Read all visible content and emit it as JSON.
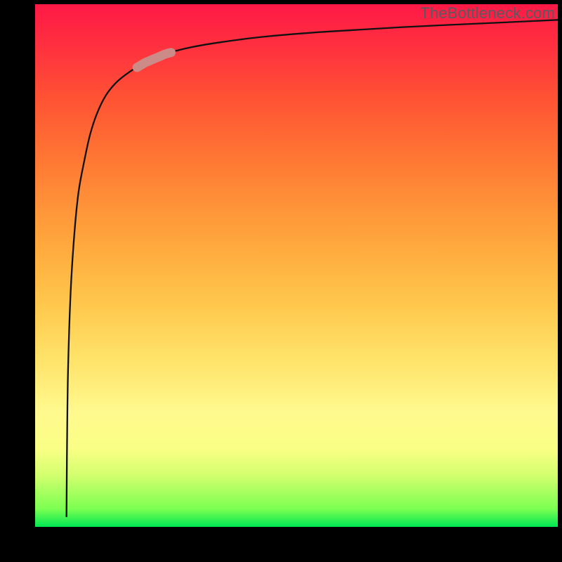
{
  "watermark": "TheBottleneck.com",
  "colors": {
    "frame": "#000000",
    "curve": "#111111",
    "highlight_fill": "#cc8b86",
    "highlight_stroke": "#cc8b86"
  },
  "chart_data": {
    "type": "line",
    "title": "",
    "xlabel": "",
    "ylabel": "",
    "xlim": [
      0,
      100
    ],
    "ylim": [
      0,
      100
    ],
    "grid": false,
    "series": [
      {
        "name": "curve",
        "x": [
          6.0,
          6.1,
          6.3,
          6.8,
          7.5,
          8.3,
          9.4,
          10.5,
          11.8,
          13.5,
          15.5,
          18.0,
          21.0,
          25.0,
          30.0,
          36.0,
          44.0,
          55.0,
          70.0,
          85.0,
          100.0
        ],
        "y": [
          2.0,
          15.0,
          30.0,
          45.0,
          56.0,
          64.0,
          70.0,
          75.0,
          79.0,
          82.5,
          85.0,
          87.0,
          88.8,
          90.5,
          91.8,
          92.8,
          93.8,
          94.7,
          95.6,
          96.3,
          97.0
        ]
      }
    ],
    "highlight_segment": {
      "x_start": 19.5,
      "x_end": 26.0
    }
  }
}
